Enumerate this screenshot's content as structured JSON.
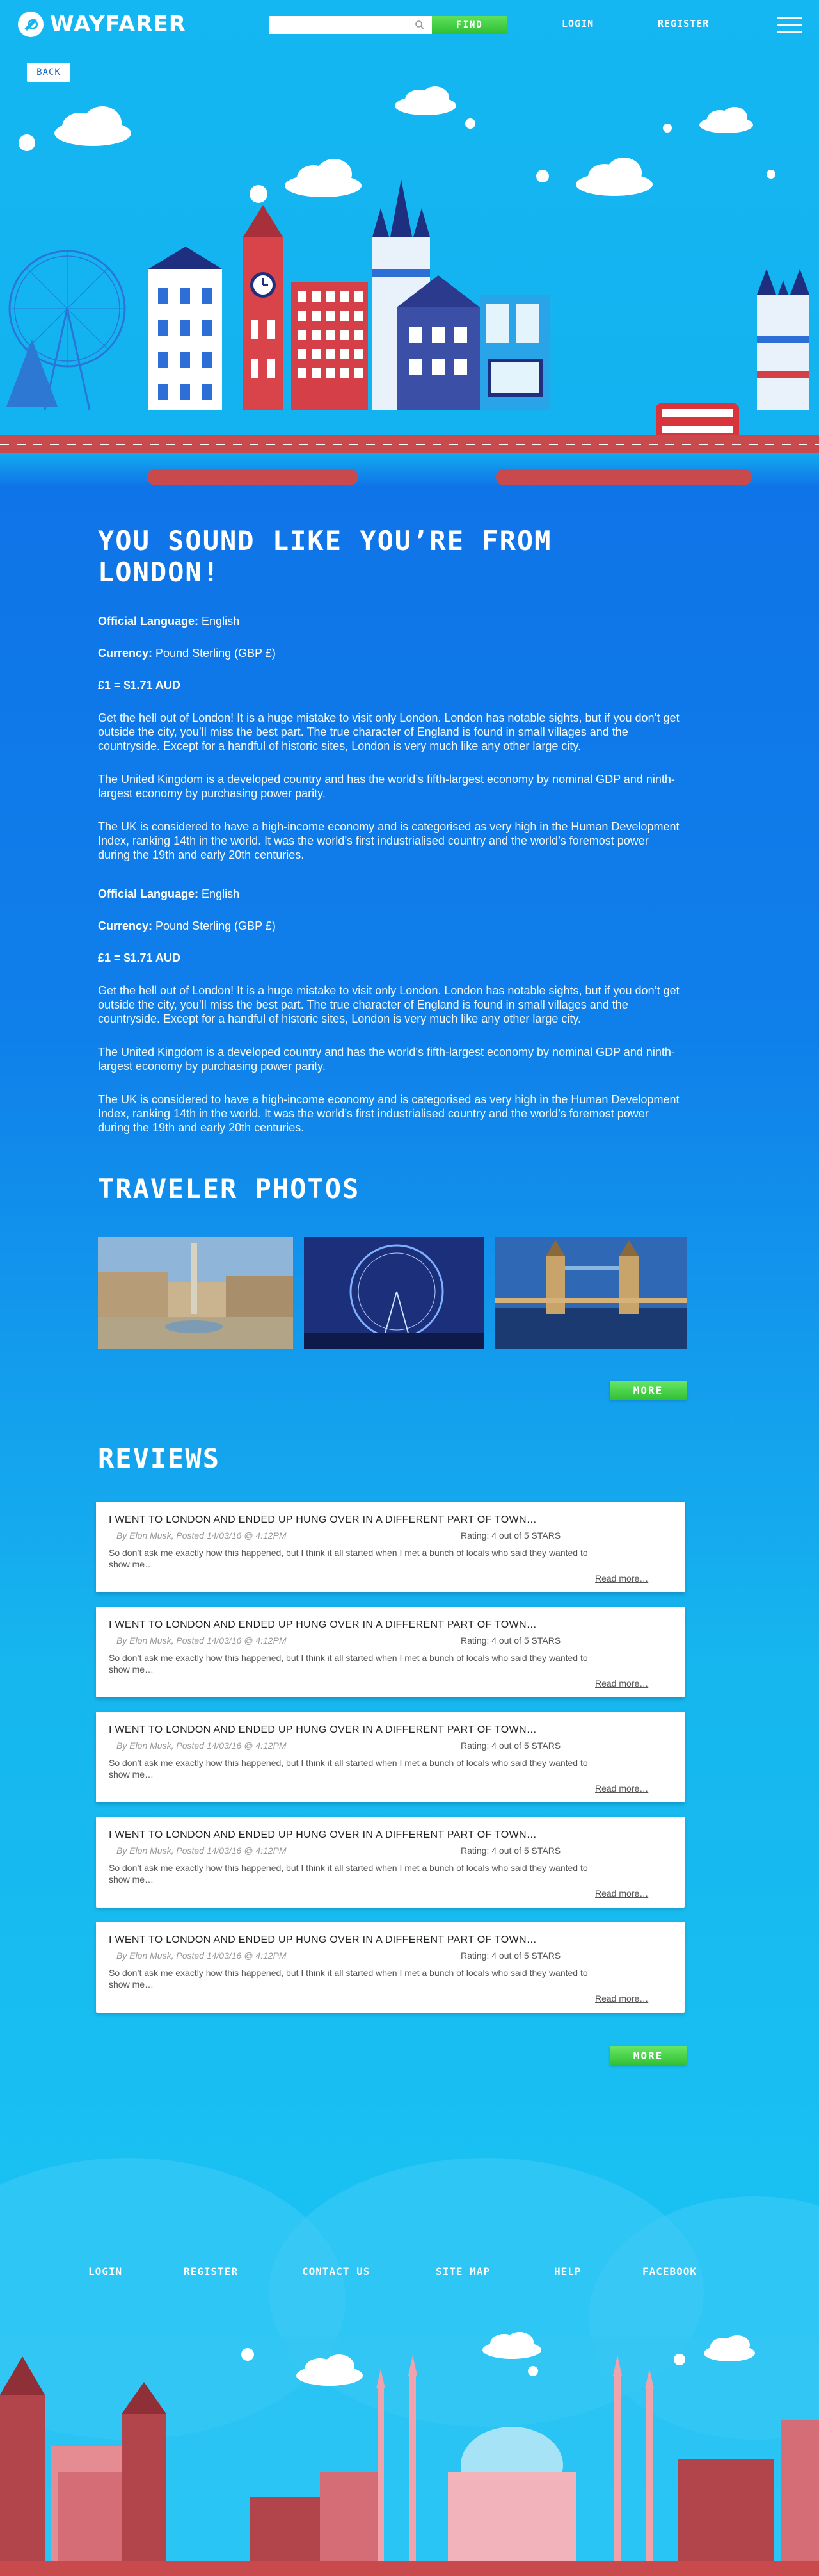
{
  "header": {
    "logo_text": "WAYFARER",
    "search": {
      "placeholder": "",
      "button_label": "FIND"
    },
    "login_label": "LOGIN",
    "register_label": "REGISTER"
  },
  "back_label": "BACK",
  "main": {
    "headline": "YOU SOUND LIKE YOU’RE FROM LONDON!",
    "blocks": [
      {
        "language_label": "Official Language:",
        "language": "English",
        "currency_label": "Currency:",
        "currency": "Pound Sterling (GBP £)",
        "rate": "£1 = $1.71 AUD",
        "p1": "Get the hell out of London! It is a huge mistake to visit only London. London has notable sights, but if you don’t get outside the city, you’ll miss the best part. The true character of England is found in small villages and the countryside. Except for a handful of historic sites, London is very much like any other large city.",
        "p2": "The United Kingdom is a developed country and has the world’s fifth-largest economy by nominal GDP and ninth-largest economy by purchasing power parity.",
        "p3": "The UK is considered to have a high-income economy and is categorised as very high in the Human Development Index, ranking 14th in the world. It was the world’s first industrialised country and the world’s foremost power during the 19th and early 20th centuries."
      },
      {
        "language_label": "Official Language:",
        "language": "English",
        "currency_label": "Currency:",
        "currency": "Pound Sterling (GBP £)",
        "rate": "£1 = $1.71 AUD",
        "p1": "Get the hell out of London! It is a huge mistake to visit only London. London has notable sights, but if you don’t get outside the city, you’ll miss the best part. The true character of England is found in small villages and the countryside. Except for a handful of historic sites, London is very much like any other large city.",
        "p2": "The United Kingdom is a developed country and has the world’s fifth-largest economy by nominal GDP and ninth-largest economy by purchasing power parity.",
        "p3": "The UK is considered to have a high-income economy and is categorised as very high in the Human Development Index, ranking 14th in the world. It was the world’s first industrialised country and the world’s foremost power during the 19th and early 20th centuries."
      }
    ]
  },
  "photos": {
    "title": "TRAVELER PHOTOS",
    "items": [
      "trafalgar-square-photo",
      "london-eye-photo",
      "tower-bridge-photo"
    ],
    "more_label": "MORE"
  },
  "reviews": {
    "title": "REVIEWS",
    "more_label": "MORE",
    "items": [
      {
        "title": "I WENT TO LONDON AND ENDED UP HUNG  OVER IN A DIFFERENT PART OF TOWN…",
        "author": "By Elon Musk, Posted 14/03/16 @ 4:12PM",
        "rating": "Rating: 4 out of 5 STARS",
        "body": "So don’t ask me exactly how this happened, but I think it all started when I met a bunch of locals who said they wanted to show me…",
        "read_more": "Read more…"
      },
      {
        "title": "I WENT TO LONDON AND ENDED UP HUNG  OVER IN A DIFFERENT PART OF TOWN…",
        "author": "By Elon Musk, Posted 14/03/16 @ 4:12PM",
        "rating": "Rating: 4 out of 5 STARS",
        "body": "So don’t ask me exactly how this happened, but I think it all started when I met a bunch of locals who said they wanted to show me…",
        "read_more": "Read more…"
      },
      {
        "title": "I WENT TO LONDON AND ENDED UP HUNG  OVER IN A DIFFERENT PART OF TOWN…",
        "author": "By Elon Musk, Posted 14/03/16 @ 4:12PM",
        "rating": "Rating: 4 out of 5 STARS",
        "body": "So don’t ask me exactly how this happened, but I think it all started when I met a bunch of locals who said they wanted to show me…",
        "read_more": "Read more…"
      },
      {
        "title": "I WENT TO LONDON AND ENDED UP HUNG  OVER IN A DIFFERENT PART OF TOWN…",
        "author": "By Elon Musk, Posted 14/03/16 @ 4:12PM",
        "rating": "Rating: 4 out of 5 STARS",
        "body": "So don’t ask me exactly how this happened, but I think it all started when I met a bunch of locals who said they wanted to show me…",
        "read_more": "Read more…"
      },
      {
        "title": "I WENT TO LONDON AND ENDED UP HUNG  OVER IN A DIFFERENT PART OF TOWN…",
        "author": "By Elon Musk, Posted 14/03/16 @ 4:12PM",
        "rating": "Rating: 4 out of 5 STARS",
        "body": "So don’t ask me exactly how this happened, but I think it all started when I met a bunch of locals who said they wanted to show me…",
        "read_more": "Read more…"
      }
    ]
  },
  "footer": {
    "links": [
      "LOGIN",
      "REGISTER",
      "CONTACT US",
      "SITE MAP",
      "HELP",
      "FACEBOOK"
    ]
  },
  "colors": {
    "sky": "#14b7f2",
    "accent_green": "#3fcf3f",
    "content_blue": "#0f74e8",
    "road_red": "#c94a4d"
  }
}
